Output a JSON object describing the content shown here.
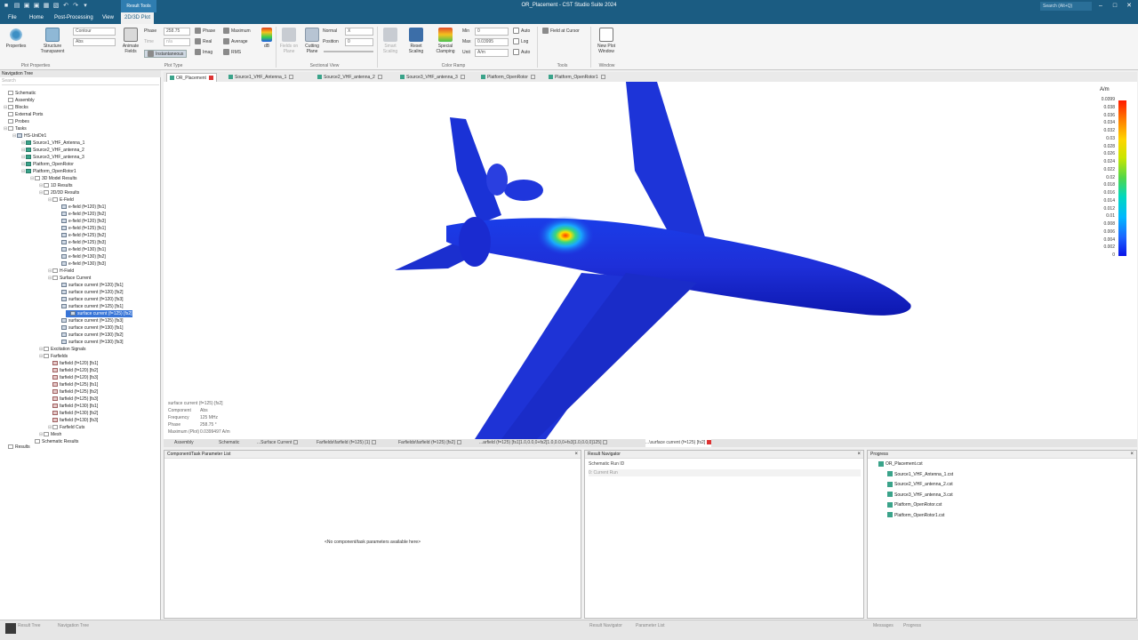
{
  "window": {
    "title": "OR_Placement - CST Studio Suite 2024",
    "search_placeholder": "Search (Alt+Q)",
    "context_tab": "Result Tools"
  },
  "menu": {
    "tabs": [
      "File",
      "Home",
      "Post-Processing",
      "View",
      "2D/3D Plot"
    ]
  },
  "ribbon": {
    "properties": "Properties",
    "structure_transparent": "Structure\nTransparent",
    "plot_type": "Contour",
    "complex_mode": "Abs",
    "animate_fields": "Animate\nFields",
    "phase_label": "Phase",
    "phase_value": "258.75",
    "time_label": "Time",
    "time_value": "n/a",
    "instantaneous": "Instantaneous",
    "phase": "Phase",
    "real": "Real",
    "imag": "Imag",
    "maximum": "Maximum",
    "average": "Average",
    "rms": "RMS",
    "db": "dB",
    "fields_on_plane": "Fields on\nPlane",
    "cutting_plane": "Cutting\nPlane",
    "normal_label": "Normal",
    "normal_value": "X",
    "position_label": "Position",
    "position_value": "0",
    "smart_scaling": "Smart\nScaling",
    "reset_scaling": "Reset\nScaling",
    "special_clamping": "Special\nClamping",
    "min_label": "Min",
    "min_value": "0",
    "max_label": "Max",
    "max_value": "0.03995",
    "unit_label": "Unit",
    "unit_value": "A/m",
    "auto1": "Auto",
    "log": "Log",
    "auto2": "Auto",
    "field_at_cursor": "Field at Cursor",
    "new_plot_window": "New Plot\nWindow",
    "groups": [
      "Plot Properties",
      "Plot Type",
      "Sectional View",
      "Color Ramp",
      "Tools",
      "Window"
    ]
  },
  "nav": {
    "title": "Navigation Tree",
    "search": "Search",
    "items": [
      {
        "label": "Schematic",
        "icon": "folder"
      },
      {
        "label": "Assembly",
        "icon": "folder"
      },
      {
        "label": "Blocks",
        "icon": "folder"
      },
      {
        "label": "External Ports",
        "icon": "folder"
      },
      {
        "label": "Probes",
        "icon": "folder"
      },
      {
        "label": "Tasks",
        "icon": "folder"
      },
      {
        "label": "HS-UniDir1",
        "icon": "res"
      },
      {
        "label": "Source1_VHF_Antenna_1",
        "icon": "green"
      },
      {
        "label": "Source2_VHF_antenna_2",
        "icon": "green"
      },
      {
        "label": "Source3_VHF_antenna_3",
        "icon": "green"
      },
      {
        "label": "Platform_OpenRotor",
        "icon": "green"
      },
      {
        "label": "Platform_OpenRotor1",
        "icon": "green"
      },
      {
        "label": "3D Model Results",
        "icon": "folder"
      },
      {
        "label": "1D Results",
        "icon": "folder"
      },
      {
        "label": "2D/3D Results",
        "icon": "folder"
      },
      {
        "label": "E-Field",
        "icon": "folder"
      },
      {
        "label": "e-field (f=120) [fs1]",
        "icon": "res"
      },
      {
        "label": "e-field (f=120) [fs2]",
        "icon": "res"
      },
      {
        "label": "e-field (f=120) [fs3]",
        "icon": "res"
      },
      {
        "label": "e-field (f=125) [fs1]",
        "icon": "res"
      },
      {
        "label": "e-field (f=125) [fs2]",
        "icon": "res"
      },
      {
        "label": "e-field (f=125) [fs3]",
        "icon": "res"
      },
      {
        "label": "e-field (f=130) [fs1]",
        "icon": "res"
      },
      {
        "label": "e-field (f=130) [fs2]",
        "icon": "res"
      },
      {
        "label": "e-field (f=130) [fs3]",
        "icon": "res"
      },
      {
        "label": "H-Field",
        "icon": "folder"
      },
      {
        "label": "Surface Current",
        "icon": "folder"
      },
      {
        "label": "surface current (f=120) [fs1]",
        "icon": "res"
      },
      {
        "label": "surface current (f=120) [fs2]",
        "icon": "res"
      },
      {
        "label": "surface current (f=120) [fs3]",
        "icon": "res"
      },
      {
        "label": "surface current (f=125) [fs1]",
        "icon": "res"
      },
      {
        "label": "surface current (f=125) [fs2]",
        "icon": "res"
      },
      {
        "label": "surface current (f=125) [fs3]",
        "icon": "res"
      },
      {
        "label": "surface current (f=130) [fs1]",
        "icon": "res"
      },
      {
        "label": "surface current (f=130) [fs2]",
        "icon": "res"
      },
      {
        "label": "surface current (f=130) [fs3]",
        "icon": "res"
      },
      {
        "label": "Excitation Signals",
        "icon": "folder"
      },
      {
        "label": "Farfields",
        "icon": "folder"
      },
      {
        "label": "farfield (f=120) [fs1]",
        "icon": "ff"
      },
      {
        "label": "farfield (f=120) [fs2]",
        "icon": "ff"
      },
      {
        "label": "farfield (f=120) [fs3]",
        "icon": "ff"
      },
      {
        "label": "farfield (f=125) [fs1]",
        "icon": "ff"
      },
      {
        "label": "farfield (f=125) [fs2]",
        "icon": "ff"
      },
      {
        "label": "farfield (f=125) [fs3]",
        "icon": "ff"
      },
      {
        "label": "farfield (f=130) [fs1]",
        "icon": "ff"
      },
      {
        "label": "farfield (f=130) [fs2]",
        "icon": "ff"
      },
      {
        "label": "farfield (f=130) [fs3]",
        "icon": "ff"
      },
      {
        "label": "Farfield Cuts",
        "icon": "folder"
      },
      {
        "label": "Mesh",
        "icon": "folder"
      },
      {
        "label": "Schematic Results",
        "icon": "folder"
      },
      {
        "label": "Results",
        "icon": "folder"
      }
    ]
  },
  "doc_tabs": [
    "OR_Placement",
    "Source1_VHF_Antenna_1",
    "Source2_VHF_antenna_2",
    "Source3_VHF_antenna_3",
    "Platform_OpenRotor",
    "Platform_OpenRotor1"
  ],
  "viewport": {
    "info_title": "surface current (f=125) [fs2]",
    "info": [
      {
        "k": "Component",
        "v": "Abs"
      },
      {
        "k": "Frequency",
        "v": "125 MHz"
      },
      {
        "k": "Phase",
        "v": "258.75 °"
      },
      {
        "k": "Maximum (Plot)",
        "v": "0.0399497 A/m"
      }
    ],
    "colorbar_unit": "A/m",
    "colorbar_ticks": [
      "0.0399",
      "0.038",
      "0.036",
      "0.034",
      "0.032",
      "0.03",
      "0.028",
      "0.026",
      "0.024",
      "0.022",
      "0.02",
      "0.018",
      "0.016",
      "0.014",
      "0.012",
      "0.01",
      "0.008",
      "0.006",
      "0.004",
      "0.002",
      "0"
    ],
    "colors": {
      "low": "#0a12e8",
      "high": "#ff1a00"
    }
  },
  "bottom_tabs": [
    "Assembly",
    "Schematic",
    "...Surface Current",
    "Farfields\\farfield (f=125) [1]",
    "Farfields\\farfield (f=125) [fs2]",
    "...arfield (f=125) [fs1]1.0,0.0,0+fs2[1.0,0.0,0+fs3[1.0,0.0,0]125]",
    "...\\surface current (f=125) [fs2]"
  ],
  "panels": {
    "params": {
      "title": "Component/Task Parameter List",
      "empty": "<No component/task parameters available here>"
    },
    "result_nav": {
      "title": "Result Navigator",
      "col": "Schematic Run ID",
      "row": "0: Current Run"
    },
    "progress": {
      "title": "Progress",
      "items": [
        "OR_Placement.cst",
        "Source1_VHF_Antenna_1.cst",
        "Source2_VHF_antenna_2.cst",
        "Source3_VHF_antenna_3.cst",
        "Platform_OpenRotor.cst",
        "Platform_OpenRotor1.cst"
      ]
    }
  },
  "status": {
    "left_tabs": [
      "Result Tree",
      "Navigation Tree"
    ],
    "mid_tabs": [
      "Result Navigator",
      "Parameter List"
    ],
    "right_tabs": [
      "Messages",
      "Progress"
    ]
  }
}
